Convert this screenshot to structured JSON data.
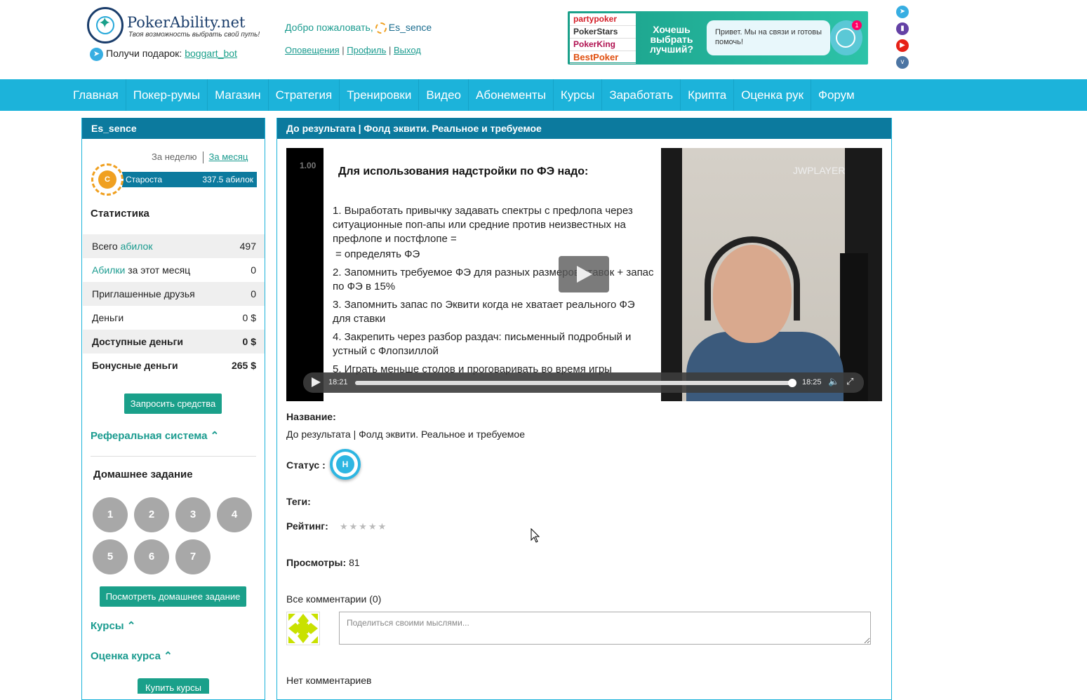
{
  "header": {
    "logo_title": "PokerAbility.net",
    "logo_tagline": "Твоя возможность выбрать свой путь!",
    "gift_label": "Получи подарок:",
    "gift_link": "boggart_bot",
    "welcome_label": "Добро пожаловать,",
    "username": "Es_sence",
    "links": [
      "Оповещения",
      "Профиль",
      "Выход"
    ],
    "banner": {
      "brands": [
        "partypoker",
        "PokerStars",
        "PokerKing",
        "BestPoker"
      ],
      "slogan": "Хочешь выбрать лучший?",
      "chat_text": "Привет. Мы на связи и готовы помочь!",
      "chat_badge": "1"
    },
    "social_icons": [
      "telegram-icon",
      "twitch-icon",
      "youtube-icon",
      "vk-icon"
    ],
    "colors": {
      "teal": "#1aa08a",
      "nav": "#1cb3da",
      "panel_head": "#0c7a9e"
    }
  },
  "nav": [
    "Главная",
    "Покер-румы",
    "Магазин",
    "Стратегия",
    "Тренировки",
    "Видео",
    "Абонементы",
    "Курсы",
    "Заработать",
    "Крипта",
    "Оценка рук",
    "Форум"
  ],
  "sidebar": {
    "title": "Es_sence",
    "period_week": "За неделю",
    "period_month": "За месяц",
    "rank_icon_letter": "С",
    "rank_name": "Староста",
    "rank_value": "337.5 абилок",
    "stats_title": "Статистика",
    "stats": {
      "total_prefix": "Всего",
      "total_link": "абилок",
      "total_value": "497",
      "month_link": "Абилки",
      "month_suffix": "за этот месяц",
      "month_value": "0",
      "friends_label": "Приглашенные друзья",
      "friends_value": "0",
      "money_label": "Деньги",
      "money_value": "0 $",
      "available_label": "Доступные деньги",
      "available_value": "0 $",
      "bonus_label": "Бонусные деньги",
      "bonus_value": "265 $"
    },
    "request_button": "Запросить средства",
    "referral_label": "Реферальная система",
    "homework_title": "Домашнее задание",
    "homework_items": [
      "1",
      "2",
      "3",
      "4",
      "5",
      "6",
      "7"
    ],
    "view_homework_button": "Посмотреть домашнее задание",
    "courses_label": "Курсы",
    "course_rating_label": "Оценка курса",
    "buy_courses_button": "Купить курсы"
  },
  "main": {
    "title": "До результата | Фолд эквити. Реальное и требуемое",
    "video": {
      "slide_number": "1.00",
      "slide_heading": "Для использования надстройки по ФЭ надо:",
      "slide_items": [
        "1. Выработать привычку задавать спектры с префлопа через ситуационные поп-апы или средние против неизвестных на префлопе и постфлопе =",
        " = определять ФЭ",
        "2. Запомнить требуемое ФЭ для разных размеров ставок + запас по ФЭ в 15%",
        "3. Запомнить запас по Эквити когда не хватает реального ФЭ для ставки",
        "4. Закрепить через разбор раздач: письменный подробный и устный с Флопзиллой",
        "5. Играть меньше столов и проговаривать во время игры"
      ],
      "player_brand": "JWPLAYER",
      "time_elapsed": "18:21",
      "time_total": "18:25",
      "progress": 0.996
    },
    "name_label": "Название:",
    "name_value": "До результата | Фолд эквити. Реальное и требуемое",
    "status_label": "Статус :",
    "status_letter": "Н",
    "tags_label": "Теги:",
    "rating_label": "Рейтинг:",
    "rating_stars": "★★★★★",
    "views_label": "Просмотры:",
    "views_value": "81",
    "comments_header": "Все комментарии (0)",
    "comment_placeholder": "Поделиться своими мыслями...",
    "no_comments": "Нет комментариев"
  }
}
